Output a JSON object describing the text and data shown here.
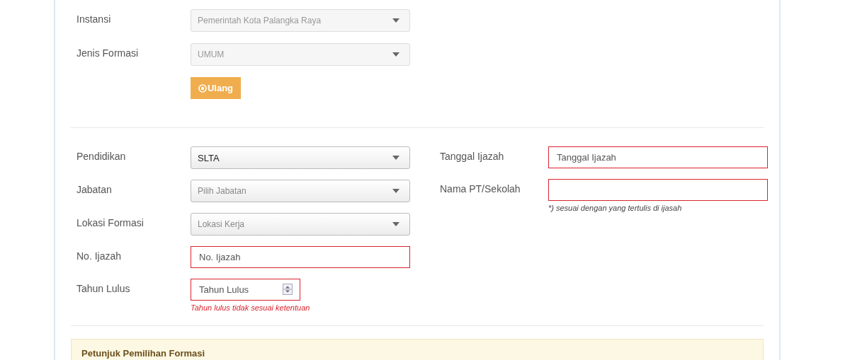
{
  "top_fields": [
    {
      "label": "Instansi",
      "kind": "select",
      "value": "Pemerintah Kota Palangka Raya",
      "disabled": true,
      "invalid": false
    },
    {
      "label": "Jenis Formasi",
      "kind": "select",
      "value": "UMUM",
      "disabled": true,
      "invalid": false
    }
  ],
  "reset_button": {
    "label": "Ulang"
  },
  "left_fields": [
    {
      "label": "Pendidikan",
      "kind": "select",
      "value": "SLTA",
      "disabled": false,
      "invalid": false
    },
    {
      "label": "Jabatan",
      "kind": "select",
      "placeholder": "Pilih Jabatan",
      "disabled": false,
      "invalid": false
    },
    {
      "label": "Lokasi Formasi",
      "kind": "select",
      "placeholder": "Lokasi Kerja",
      "disabled": false,
      "invalid": false
    },
    {
      "label": "No. Ijazah",
      "kind": "text",
      "placeholder": "No. Ijazah",
      "invalid": true
    },
    {
      "label": "Tahun Lulus",
      "kind": "number",
      "placeholder": "Tahun Lulus",
      "invalid": true,
      "error": "Tahun lulus tidak sesuai ketentuan"
    }
  ],
  "right_fields": [
    {
      "label": "Tanggal Ijazah",
      "kind": "text",
      "placeholder": "Tanggal Ijazah",
      "invalid": true
    },
    {
      "label": "Nama PT/Sekolah",
      "kind": "text",
      "invalid": true,
      "hint": "*) sesuai dengan yang tertulis di ijasah"
    }
  ],
  "notice": {
    "title": "Petunjuk Pemilihan Formasi"
  }
}
